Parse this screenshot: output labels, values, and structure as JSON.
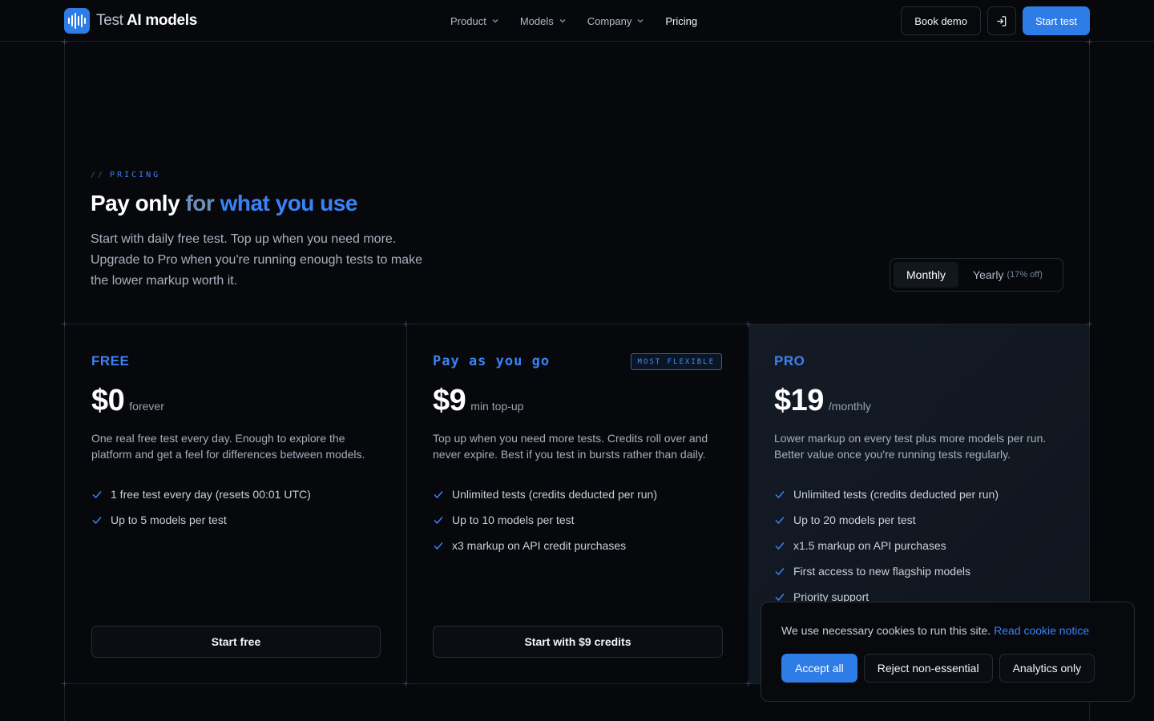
{
  "brand": {
    "name_prefix": "Test",
    "name_main": "AI models"
  },
  "nav": {
    "items": [
      {
        "label": "Product"
      },
      {
        "label": "Models"
      },
      {
        "label": "Company"
      },
      {
        "label": "Pricing"
      }
    ]
  },
  "header_actions": {
    "book_demo": "Book demo",
    "start_test": "Start test",
    "login_icon": "sign-in-icon"
  },
  "hero": {
    "eyebrow_prefix": "//",
    "eyebrow": "PRICING",
    "title_a": "Pay only",
    "title_b": "for",
    "title_c": "what you use",
    "subtitle": "Start with daily free test. Top up when you need more. Upgrade to Pro when you're running enough tests to make the lower markup worth it."
  },
  "billing_toggle": {
    "monthly": "Monthly",
    "yearly": "Yearly",
    "yearly_discount": "(17% off)",
    "selected": "Monthly"
  },
  "plans": [
    {
      "name": "FREE",
      "price": "$0",
      "period": "forever",
      "description": "One real free test every day. Enough to explore the platform and get a feel for differences between models.",
      "features": [
        "1 free test every day (resets 00:01 UTC)",
        "Up to 5 models per test"
      ],
      "cta": "Start free"
    },
    {
      "name": "Pay as you go",
      "badge": "MOST FLEXIBLE",
      "price": "$9",
      "period": "min top-up",
      "description": "Top up when you need more tests. Credits roll over and never expire. Best if you test in bursts rather than daily.",
      "features": [
        "Unlimited tests (credits deducted per run)",
        "Up to 10 models per test",
        "x3 markup on API credit purchases"
      ],
      "cta": "Start with $9 credits"
    },
    {
      "name": "PRO",
      "price": "$19",
      "period": "/monthly",
      "description": "Lower markup on every test plus more models per run. Better value once you're running tests regularly.",
      "features": [
        "Unlimited tests (credits deducted per run)",
        "Up to 20 models per test",
        "x1.5 markup on API purchases",
        "First access to new flagship models",
        "Priority support"
      ]
    }
  ],
  "cookie": {
    "text": "We use necessary cookies to run this site.",
    "link": "Read cookie notice",
    "accept": "Accept all",
    "reject": "Reject non-essential",
    "analytics": "Analytics only"
  },
  "colors": {
    "accent": "#2e7ce6",
    "background": "#06080c"
  }
}
